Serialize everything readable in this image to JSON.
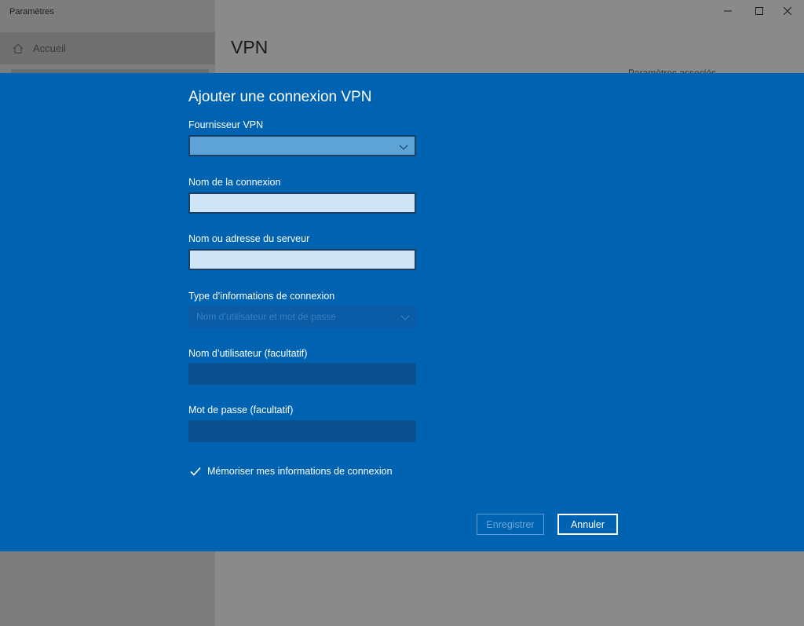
{
  "window": {
    "title": "Paramètres",
    "controls": {
      "minimize_icon": "minimize-icon",
      "maximize_icon": "maximize-icon",
      "close_icon": "close-icon"
    }
  },
  "sidebar": {
    "home_label": "Accueil",
    "home_icon": "home-icon"
  },
  "content": {
    "heading": "VPN",
    "related_partial": "Paramètres associés"
  },
  "dialog": {
    "title": "Ajouter une connexion VPN",
    "provider": {
      "label": "Fournisseur VPN",
      "value": ""
    },
    "connection_name": {
      "label": "Nom de la connexion",
      "value": ""
    },
    "server": {
      "label": "Nom ou adresse du serveur",
      "value": ""
    },
    "sign_in_type": {
      "label": "Type d’informations de connexion",
      "value": "Nom d’utilisateur et mot de passe"
    },
    "username": {
      "label": "Nom d’utilisateur (facultatif)",
      "value": ""
    },
    "password": {
      "label": "Mot de passe (facultatif)",
      "value": ""
    },
    "remember": {
      "label": "Mémoriser mes informations de connexion",
      "checked": true
    },
    "save_label": "Enregistrer",
    "cancel_label": "Annuler"
  },
  "colors": {
    "dialog_bg": "#0063b1",
    "overlay_bg": "#8a8a8a"
  }
}
